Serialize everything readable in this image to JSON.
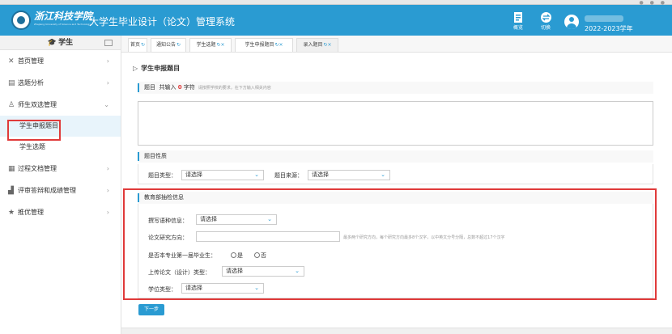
{
  "header": {
    "logo_cn": "浙江科技学院",
    "logo_en": "Zhejiang University of Science and Technology",
    "system_title": "大学生毕业设计（论文）管理系统",
    "summary_label": "概览",
    "switch_label": "切换",
    "academic_year": "2022-2023学年",
    "accent_color": "#2a9bd2"
  },
  "sidebar": {
    "title": "学生",
    "items": [
      {
        "icon": "home-icon",
        "label": "首页管理"
      },
      {
        "icon": "chart-icon",
        "label": "选题分析"
      },
      {
        "icon": "users-icon",
        "label": "师生双选管理"
      },
      {
        "icon": "document-icon",
        "label": "过程文档管理"
      },
      {
        "icon": "bar-chart-icon",
        "label": "评审答辩和成绩管理"
      },
      {
        "icon": "star-icon",
        "label": "推优管理"
      }
    ],
    "subitems": [
      {
        "label": "学生申报题目",
        "active": true
      },
      {
        "label": "学生选题",
        "active": false
      }
    ]
  },
  "tabs": [
    {
      "label": "首页",
      "closable": false
    },
    {
      "label": "通知公告",
      "closable": false
    },
    {
      "label": "学生选题",
      "closable": true
    },
    {
      "label": "学生申报题目",
      "closable": true
    },
    {
      "label": "录入题目",
      "closable": true,
      "active": true
    }
  ],
  "page": {
    "title": "学生申报题目",
    "topic": {
      "label": "题目",
      "count_prefix": "共输入",
      "count": "0",
      "count_suffix": "字符",
      "hint": "请按照学校的要求，在下方输入相关内容"
    },
    "nature": {
      "heading": "题目性质",
      "type_label": "题目类型：",
      "type_value": "请选择",
      "source_label": "题目来源：",
      "source_value": "请选择"
    },
    "edu": {
      "heading": "教育部抽检信息",
      "language_label": "撰写语种信息：",
      "language_value": "请选择",
      "direction_label": "论文研究方向：",
      "direction_value": "",
      "direction_hint": "最多两个研究方向，每个研究方向最多8个汉字，以中英文分号分隔，总数不超过17个汉字",
      "first_cohort_label": "是否本专业第一届毕业生：",
      "option_yes": "是",
      "option_no": "否",
      "upload_type_label": "上传论文（设计）类型：",
      "upload_type_value": "请选择",
      "degree_label": "学位类型：",
      "degree_value": "请选择"
    },
    "next_label": "下一步"
  }
}
